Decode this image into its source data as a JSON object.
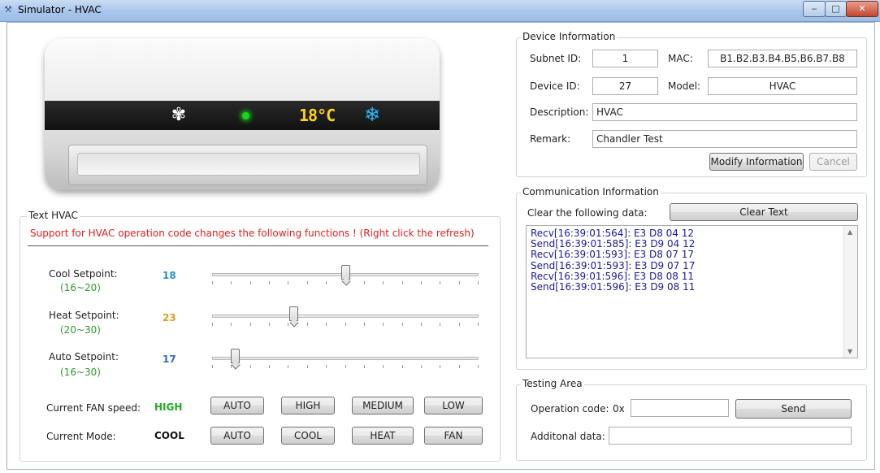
{
  "window": {
    "title": "Simulator - HVAC"
  },
  "ac_display": {
    "temperature": "18°C"
  },
  "device_info": {
    "title": "Device Information",
    "subnet_id_label": "Subnet ID:",
    "subnet_id": "1",
    "mac_label": "MAC:",
    "mac": "B1.B2.B3.B4.B5.B6.B7.B8",
    "device_id_label": "Device ID:",
    "device_id": "27",
    "model_label": "Model:",
    "model": "HVAC",
    "description_label": "Description:",
    "description": "HVAC",
    "remark_label": "Remark:",
    "remark": "Chandler Test",
    "modify_label": "Modify Information",
    "cancel_label": "Cancel"
  },
  "communication": {
    "title": "Communication Information",
    "clear_label": "Clear the following data:",
    "clear_button": "Clear Text",
    "log": [
      "Recv[16:39:01:564]: E3 D8 04 12",
      "Send[16:39:01:585]: E3 D9 04 12",
      "Recv[16:39:01:593]: E3 D8 07 17",
      "Send[16:39:01:593]: E3 D9 07 17",
      "Recv[16:39:01:596]: E3 D8 08 11",
      "Send[16:39:01:596]: E3 D9 08 11"
    ]
  },
  "text_hvac": {
    "title": "Text HVAC",
    "notice": "Support for HVAC operation code changes the following functions ! (Right click the refresh)",
    "notice_color": "#e02020",
    "cool": {
      "label": "Cool Setpoint:",
      "range": "(16~20)",
      "value": "18",
      "color": "#2a8fc8",
      "fraction": 0.5
    },
    "heat": {
      "label": "Heat Setpoint:",
      "range": "(20~30)",
      "value": "23",
      "color": "#e0a020",
      "fraction": 0.3
    },
    "auto": {
      "label": "Auto Setpoint:",
      "range": "(16~30)",
      "value": "17",
      "color": "#2a70c8",
      "fraction": 0.0714
    },
    "range_color": "#2e9a2e",
    "fan_label": "Current FAN speed:",
    "fan_value": "HIGH",
    "fan_color": "#22aa22",
    "fan_buttons": [
      "AUTO",
      "HIGH",
      "MEDIUM",
      "LOW"
    ],
    "mode_label": "Current Mode:",
    "mode_value": "COOL",
    "mode_buttons": [
      "AUTO",
      "COOL",
      "HEAT",
      "FAN"
    ]
  },
  "testing": {
    "title": "Testing Area",
    "opcode_label": "Operation code:",
    "opcode_prefix": "0x",
    "opcode_value": "",
    "send_label": "Send",
    "additional_label": "Additonal data:",
    "additional_value": ""
  }
}
